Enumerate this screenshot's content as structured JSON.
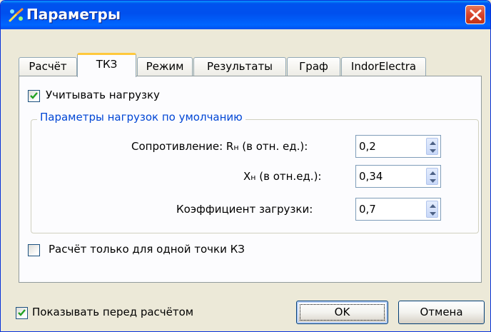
{
  "window": {
    "title": "Параметры"
  },
  "tabs": [
    {
      "label": "Расчёт",
      "active": false
    },
    {
      "label": "ТКЗ",
      "active": true
    },
    {
      "label": "Режим",
      "active": false
    },
    {
      "label": "Результаты",
      "active": false
    },
    {
      "label": "Граф",
      "active": false
    },
    {
      "label": "IndorElectra",
      "active": false
    }
  ],
  "panel": {
    "consider_load": {
      "label": "Учитывать нагрузку",
      "checked": true
    },
    "group_title": "Параметры нагрузок по умолчанию",
    "fields": [
      {
        "label_main": "Сопротивление: R",
        "label_sub": "н",
        "label_tail": " (в отн. ед.):",
        "value": "0,2"
      },
      {
        "label_main": "X",
        "label_sub": "н",
        "label_tail": " (в отн.ед.):",
        "value": "0,34"
      },
      {
        "label_main": "Коэффициент загрузки:",
        "label_sub": "",
        "label_tail": "",
        "value": "0,7"
      }
    ],
    "single_point": {
      "label": "Расчёт только для одной точки КЗ",
      "checked": false
    }
  },
  "footer": {
    "show_before": {
      "label": "Показывать перед расчётом",
      "checked": true
    },
    "ok_label": "OK",
    "cancel_label": "Отмена"
  },
  "colors": {
    "titlebar": "#0054e3",
    "group_title": "#0046d5",
    "active_tab_accent": "#ffc83c",
    "close_button": "#d8432b"
  },
  "icons": {
    "app": "parameters-app-icon",
    "close": "close-icon",
    "spin": "spin-arrows-icon",
    "check": "checkmark-icon"
  }
}
